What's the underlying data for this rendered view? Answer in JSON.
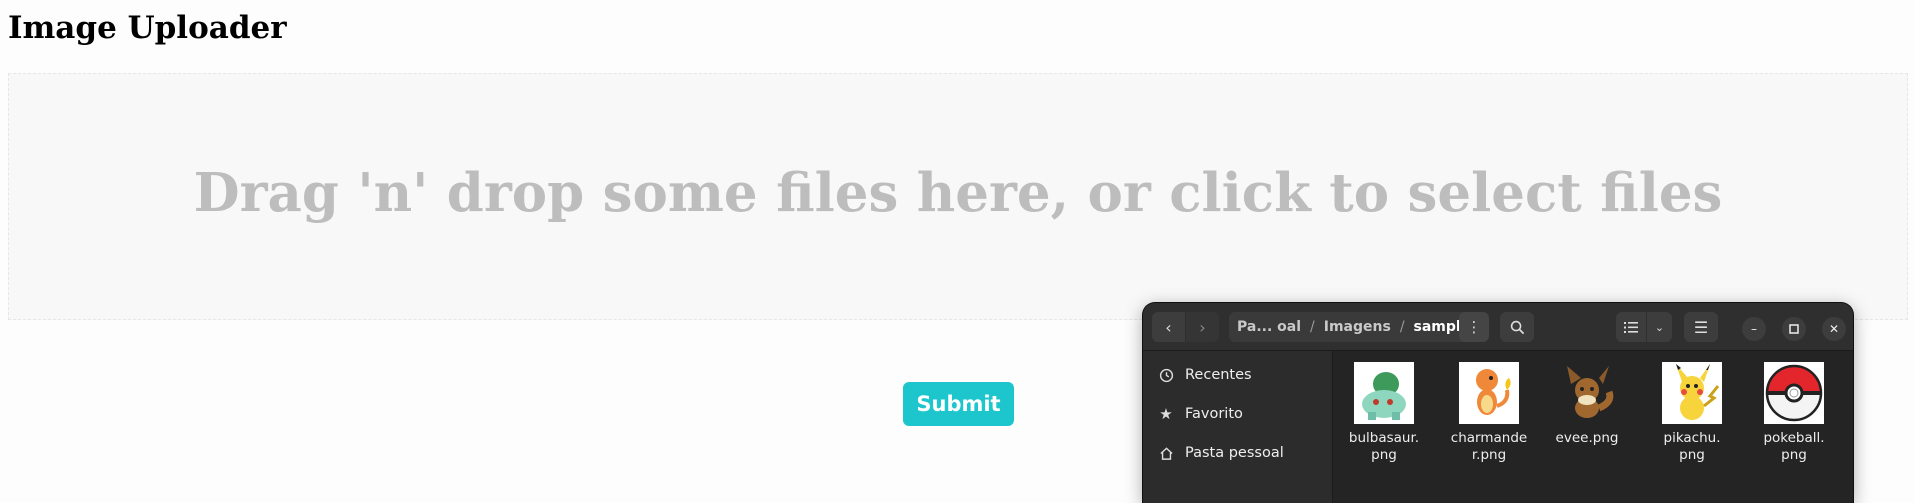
{
  "page": {
    "title": "Image Uploader",
    "dropzone_text": "Drag 'n' drop some files here, or click to select files",
    "submit_label": "Submit"
  },
  "file_manager": {
    "path": [
      {
        "label": "Pa... oal"
      },
      {
        "label": "Imagens"
      },
      {
        "label": "sample"
      }
    ],
    "separator": "/",
    "sidebar": [
      {
        "label": "Recentes",
        "icon": "clock-icon"
      },
      {
        "label": "Favorito",
        "icon": "star-icon"
      },
      {
        "label": "Pasta pessoal",
        "icon": "home-icon"
      }
    ],
    "files": [
      {
        "name": "bulbasaur.\npng",
        "icon": "bulbasaur-image"
      },
      {
        "name": "charmande\nr.png",
        "icon": "charmander-image"
      },
      {
        "name": "evee.png",
        "icon": "eevee-image"
      },
      {
        "name": "pikachu.\npng",
        "icon": "pikachu-image"
      },
      {
        "name": "pokeball.\npng",
        "icon": "pokeball-image"
      }
    ]
  },
  "colors": {
    "submit_bg": "#1cc6cc",
    "dropzone_text": "#bdbdbd",
    "fm_bg": "#242424"
  }
}
